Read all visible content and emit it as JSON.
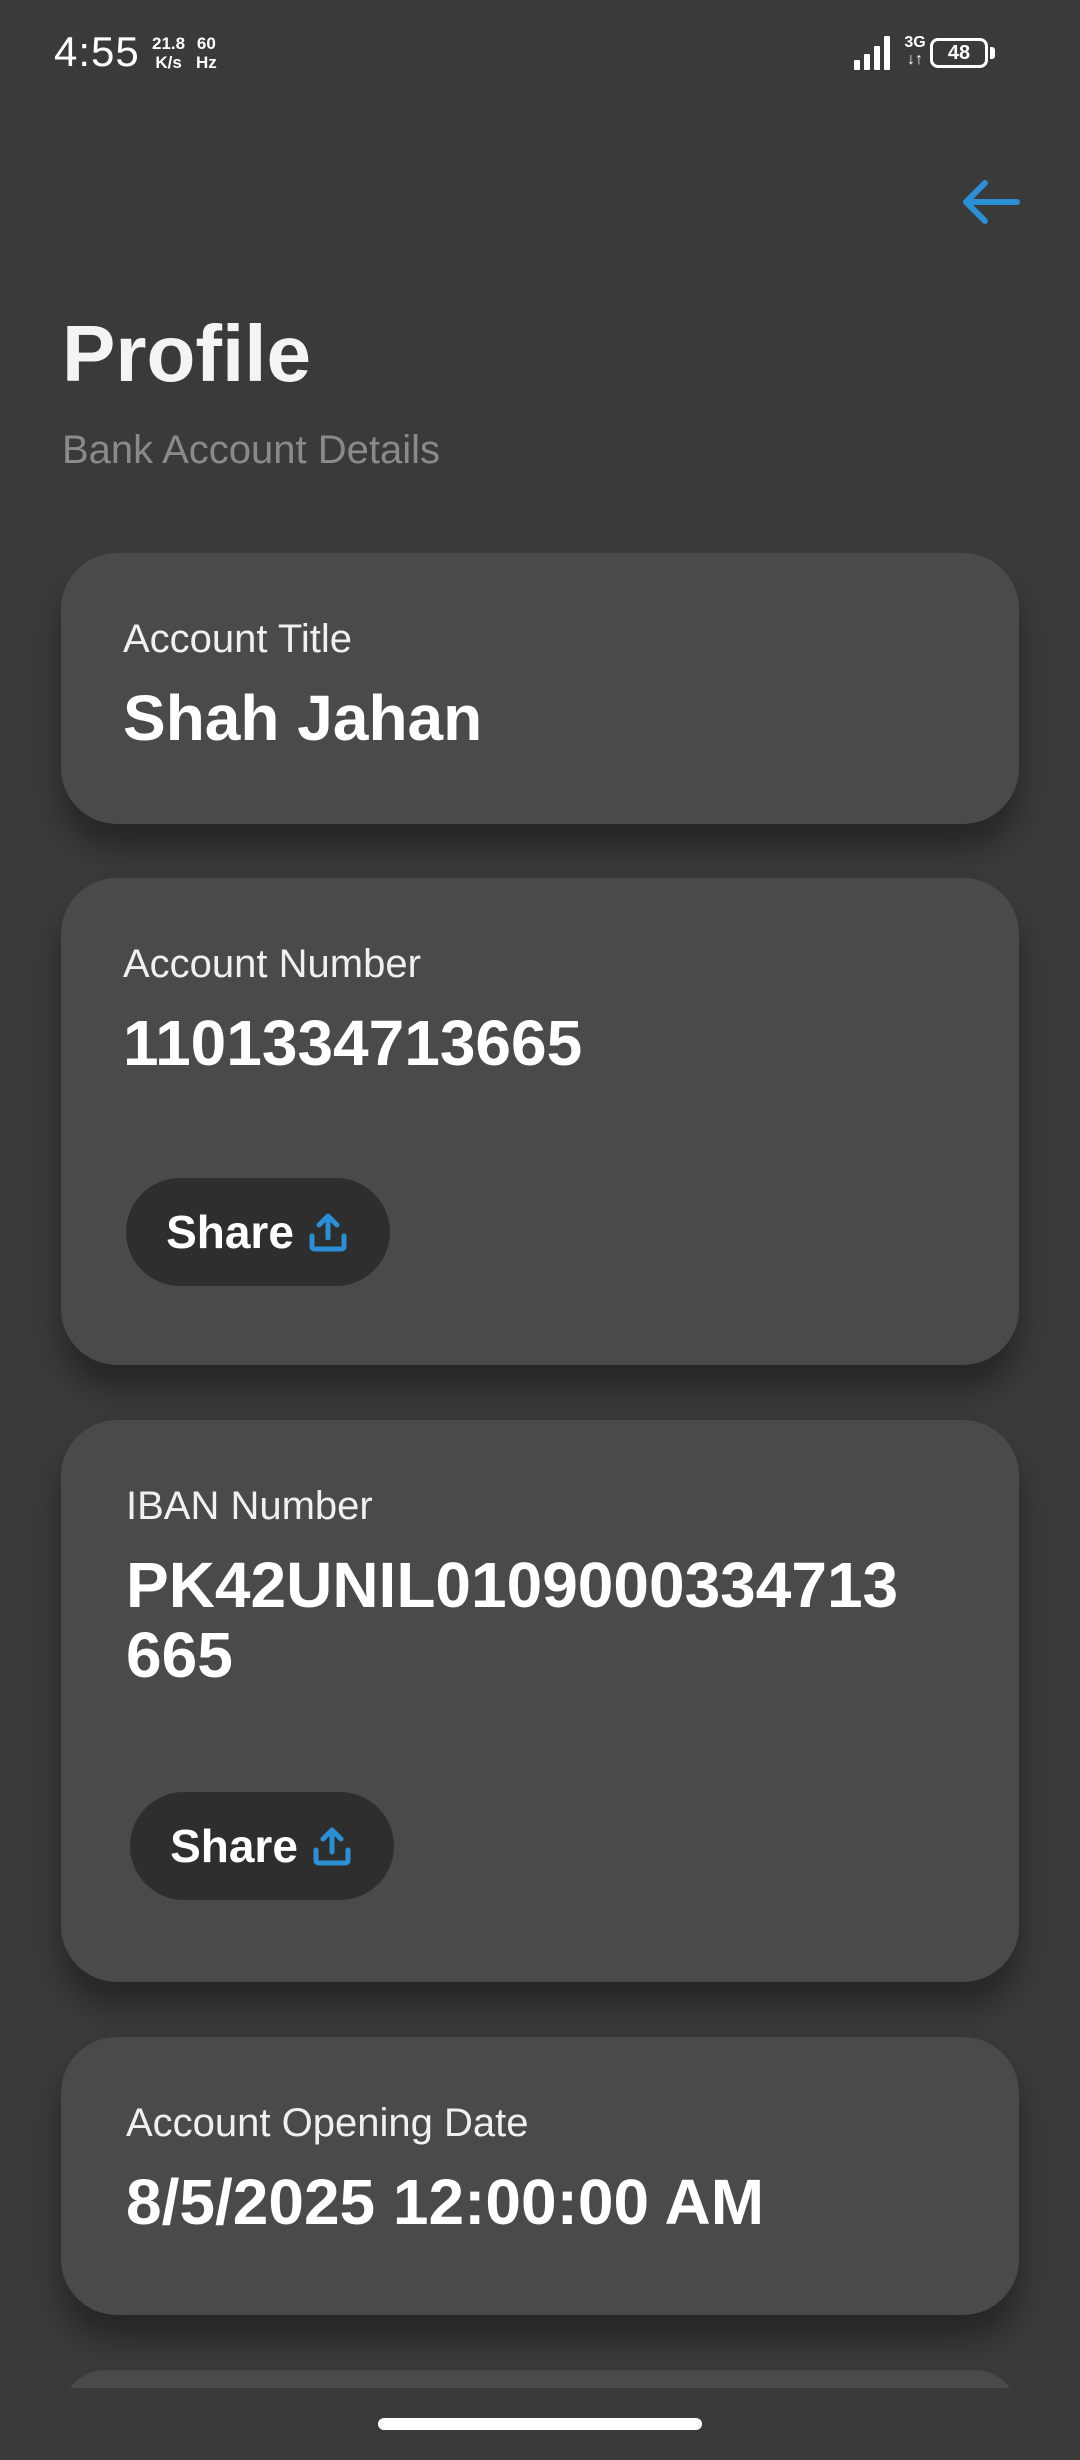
{
  "status_bar": {
    "time": "4:55",
    "net_speed_value": "21.8",
    "net_speed_unit": "K/s",
    "refresh_value": "60",
    "refresh_unit": "Hz",
    "network_type_top": "3G",
    "network_type_bottom": "↓↑",
    "battery": "48"
  },
  "header": {
    "title": "Profile",
    "subtitle": "Bank Account Details",
    "back_icon": "arrow-left-icon"
  },
  "cards": {
    "account_title": {
      "label": "Account Title",
      "value": "Shah Jahan"
    },
    "account_number": {
      "label": "Account Number",
      "value": "1101334713665",
      "share_label": "Share"
    },
    "iban": {
      "label": "IBAN Number",
      "value_line1": "PK42UNIL0109000334713",
      "value_line2": "665",
      "share_label": "Share"
    },
    "opening_date": {
      "label": "Account Opening Date",
      "value": "8/5/2025 12:00:00 AM"
    }
  },
  "colors": {
    "background": "#3a3a3a",
    "card": "#4a4a4a",
    "accent": "#2b8fd6",
    "button": "#2e2e2e"
  }
}
